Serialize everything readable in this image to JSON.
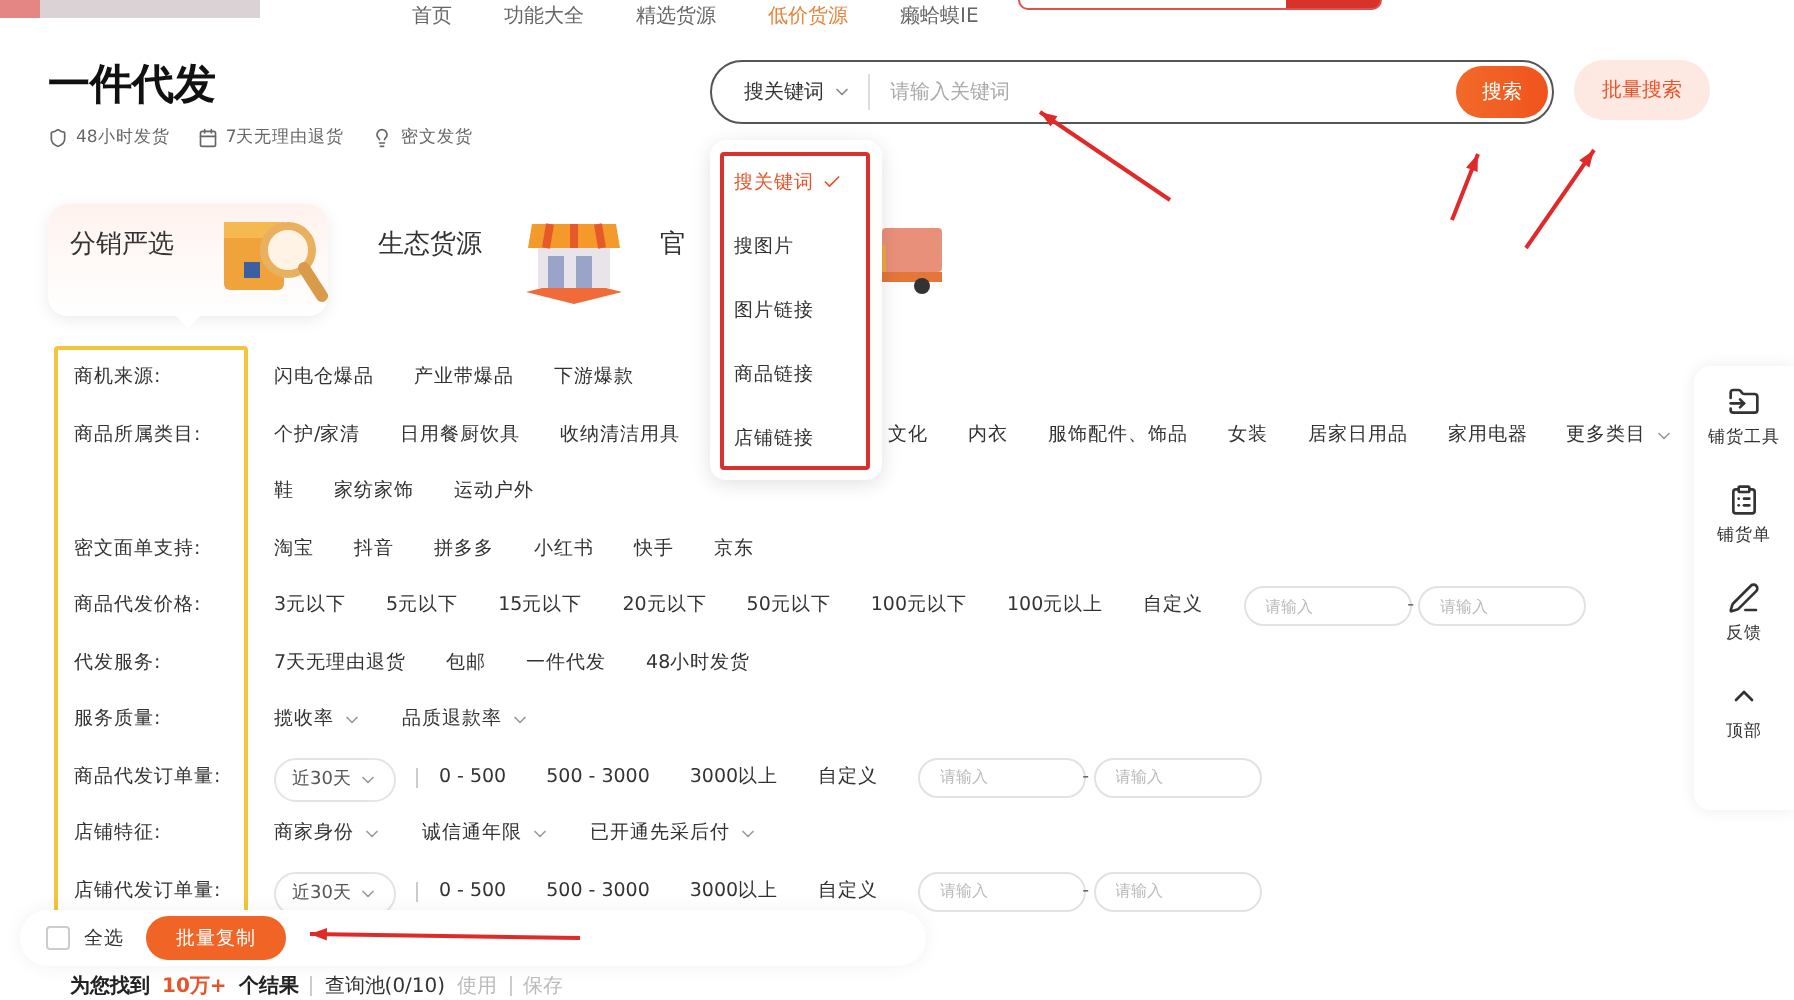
{
  "top_nav": {
    "items": [
      {
        "label": "首页",
        "selected": false
      },
      {
        "label": "功能大全",
        "selected": false
      },
      {
        "label": "精选货源",
        "selected": false
      },
      {
        "label": "低价货源",
        "selected": true
      },
      {
        "label": "癞蛤蟆IE",
        "selected": false
      }
    ]
  },
  "header": {
    "title": "一件代发",
    "features": [
      {
        "kind": "shield",
        "label": "48小时发货"
      },
      {
        "kind": "calendar",
        "label": "7天无理由退货"
      },
      {
        "kind": "bulb",
        "label": "密文发货"
      }
    ]
  },
  "search": {
    "mode": "搜关键词",
    "placeholder": "请输入关键词",
    "button": "搜索",
    "batch_button": "批量搜索"
  },
  "search_modes": [
    {
      "label": "搜关键词",
      "selected": true
    },
    {
      "label": "搜图片",
      "selected": false
    },
    {
      "label": "图片链接",
      "selected": false
    },
    {
      "label": "商品链接",
      "selected": false
    },
    {
      "label": "店铺链接",
      "selected": false
    }
  ],
  "source_tabs": [
    {
      "label": "分销严选",
      "kind": "box",
      "selected": true
    },
    {
      "label": "生态货源",
      "kind": "shop",
      "selected": false
    },
    {
      "label": "官",
      "kind": "truck",
      "selected": false
    }
  ],
  "filters": [
    {
      "label": "商机来源:",
      "items": [
        {
          "kind": "option",
          "text": "闪电仓爆品"
        },
        {
          "kind": "option",
          "text": "产业带爆品"
        },
        {
          "kind": "option",
          "text": "下游爆款"
        }
      ]
    },
    {
      "label": "商品所属类目:",
      "more": "更多类目",
      "items": [
        {
          "kind": "option",
          "text": "个护/家清"
        },
        {
          "kind": "option",
          "text": "日用餐厨饮具"
        },
        {
          "kind": "option",
          "text": "收纳清洁用具"
        },
        {
          "kind": "option",
          "text": "文化"
        },
        {
          "kind": "option",
          "text": "内衣"
        },
        {
          "kind": "option",
          "text": "服饰配件、饰品"
        },
        {
          "kind": "option",
          "text": "女装"
        },
        {
          "kind": "option",
          "text": "居家日用品"
        },
        {
          "kind": "option",
          "text": "家用电器"
        },
        {
          "kind": "option",
          "text": "鞋"
        },
        {
          "kind": "option",
          "text": "家纺家饰"
        },
        {
          "kind": "option",
          "text": "运动户外"
        }
      ]
    },
    {
      "label": "密文面单支持:",
      "items": [
        {
          "kind": "option",
          "text": "淘宝"
        },
        {
          "kind": "option",
          "text": "抖音"
        },
        {
          "kind": "option",
          "text": "拼多多"
        },
        {
          "kind": "option",
          "text": "小红书"
        },
        {
          "kind": "option",
          "text": "快手"
        },
        {
          "kind": "option",
          "text": "京东"
        }
      ]
    },
    {
      "label": "商品代发价格:",
      "items": [
        {
          "kind": "option",
          "text": "3元以下"
        },
        {
          "kind": "option",
          "text": "5元以下"
        },
        {
          "kind": "option",
          "text": "15元以下"
        },
        {
          "kind": "option",
          "text": "20元以下"
        },
        {
          "kind": "option",
          "text": "50元以下"
        },
        {
          "kind": "option",
          "text": "100元以下"
        },
        {
          "kind": "option",
          "text": "100元以上"
        },
        {
          "kind": "option",
          "text": "自定义"
        },
        {
          "kind": "input",
          "placeholder": "请输入"
        },
        {
          "kind": "dash",
          "text": "-"
        },
        {
          "kind": "input",
          "placeholder": "请输入"
        }
      ]
    },
    {
      "label": "代发服务:",
      "items": [
        {
          "kind": "option",
          "text": "7天无理由退货"
        },
        {
          "kind": "option",
          "text": "包邮"
        },
        {
          "kind": "option",
          "text": "一件代发"
        },
        {
          "kind": "option",
          "text": "48小时发货"
        }
      ]
    },
    {
      "label": "服务质量:",
      "items": [
        {
          "kind": "select",
          "text": "揽收率"
        },
        {
          "kind": "select",
          "text": "品质退款率"
        }
      ]
    },
    {
      "label": "商品代发订单量:",
      "items": [
        {
          "kind": "period",
          "text": "近30天"
        },
        {
          "kind": "separator"
        },
        {
          "kind": "option",
          "text": "0 - 500"
        },
        {
          "kind": "option",
          "text": "500 - 3000"
        },
        {
          "kind": "option",
          "text": "3000以上"
        },
        {
          "kind": "option",
          "text": "自定义"
        },
        {
          "kind": "input",
          "placeholder": "请输入"
        },
        {
          "kind": "dash",
          "text": "-"
        },
        {
          "kind": "input",
          "placeholder": "请输入"
        }
      ]
    },
    {
      "label": "店铺特征:",
      "items": [
        {
          "kind": "select",
          "text": "商家身份"
        },
        {
          "kind": "select",
          "text": "诚信通年限"
        },
        {
          "kind": "select",
          "text": "已开通先采后付"
        }
      ]
    },
    {
      "label": "店铺代发订单量:",
      "items": [
        {
          "kind": "period",
          "text": "近30天"
        },
        {
          "kind": "separator"
        },
        {
          "kind": "option",
          "text": "0 - 500"
        },
        {
          "kind": "option",
          "text": "500 - 3000"
        },
        {
          "kind": "option",
          "text": "3000以上"
        },
        {
          "kind": "option",
          "text": "自定义"
        },
        {
          "kind": "input",
          "placeholder": "请输入"
        },
        {
          "kind": "dash",
          "text": "-"
        },
        {
          "kind": "input",
          "placeholder": "请输入"
        }
      ]
    }
  ],
  "bulk_bar": {
    "select_all": {
      "label": "全选",
      "checked": false
    },
    "copy_button": "批量复制"
  },
  "results": {
    "prefix": "为您找到",
    "count": "10万+",
    "suffix": "个结果",
    "pool": "查询池(0/10)",
    "use": "使用",
    "save": "保存"
  },
  "side_tools": [
    {
      "kind": "folder",
      "label": "铺货工具"
    },
    {
      "kind": "clipboard",
      "label": "铺货单"
    },
    {
      "kind": "pen",
      "label": "反馈"
    },
    {
      "kind": "top",
      "label": "顶部"
    }
  ]
}
